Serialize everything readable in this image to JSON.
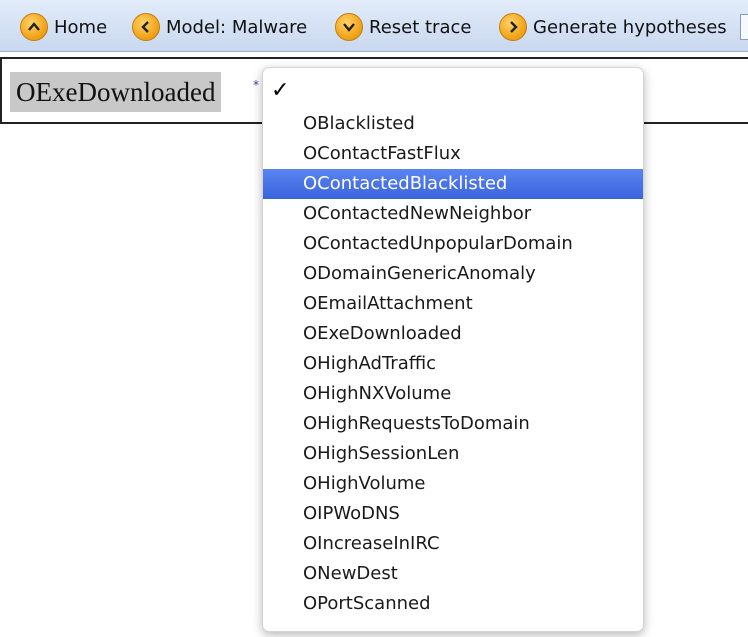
{
  "toolbar": {
    "buttons": [
      {
        "label": "Home",
        "icon": "chevron-up-icon"
      },
      {
        "label": "Model: Malware",
        "icon": "chevron-left-icon"
      },
      {
        "label": "Reset trace",
        "icon": "chevron-down-icon"
      },
      {
        "label": "Generate hypotheses",
        "icon": "chevron-right-icon"
      }
    ],
    "icon_color": "#f3a61c"
  },
  "select": {
    "current_value": "OExeDownloaded",
    "marker": "*"
  },
  "dropdown": {
    "check_glyph": "✓",
    "highlighted_index": 2,
    "highlight_color": "#3a64dc",
    "options": [
      "OBlacklisted",
      "OContactFastFlux",
      "OContactedBlacklisted",
      "OContactedNewNeighbor",
      "OContactedUnpopularDomain",
      "ODomainGenericAnomaly",
      "OEmailAttachment",
      "OExeDownloaded",
      "OHighAdTraffic",
      "OHighNXVolume",
      "OHighRequestsToDomain",
      "OHighSessionLen",
      "OHighVolume",
      "OIPWoDNS",
      "OIncreaseInIRC",
      "ONewDest",
      "OPortScanned"
    ]
  }
}
